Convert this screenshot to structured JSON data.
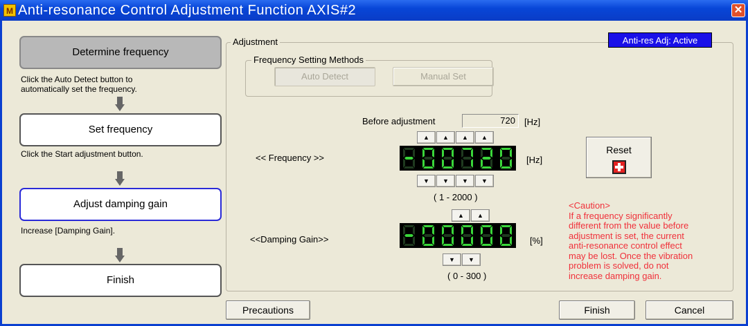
{
  "window": {
    "title": "Anti-resonance Control Adjustment Function AXIS#2",
    "app_icon": "M",
    "close_glyph": "✕"
  },
  "flow": {
    "steps": [
      {
        "label": "Determine frequency",
        "hint": [
          "Click the Auto Detect button to",
          "automatically set the frequency."
        ]
      },
      {
        "label": "Set frequency",
        "hint": [
          "Click the Start adjustment button."
        ]
      },
      {
        "label": "Adjust damping gain",
        "hint": [
          "Increase [Damping Gain]."
        ]
      },
      {
        "label": "Finish",
        "hint": []
      }
    ]
  },
  "adjustment": {
    "group_title": "Adjustment",
    "status_badge": "Anti-res Adj: Active",
    "freq_methods_title": "Frequency Setting Methods",
    "auto_detect_label": "Auto Detect",
    "manual_set_label": "Manual Set",
    "before_adjustment_label": "Before adjustment",
    "before_adjustment_value": "720",
    "hz_unit": "[Hz]",
    "frequency_label": "<< Frequency >>",
    "frequency_digits": "00720",
    "frequency_unit": "[Hz]",
    "frequency_range": "( 1 - 2000 )",
    "damping_label": "<<Damping Gain>>",
    "damping_digits": "00000",
    "damping_unit": "[%]",
    "damping_range": "( 0 - 300 )",
    "spin_up_glyph": "▲",
    "spin_down_glyph": "▼"
  },
  "reset": {
    "label": "Reset",
    "icon": "red-cross-icon"
  },
  "caution": {
    "lines": [
      "<Caution>",
      "If a frequency significantly",
      "different from the value before",
      "adjustment is set, the current",
      "anti-resonance control effect",
      "may be lost. Once the vibration",
      "problem is solved, do not",
      "increase damping gain."
    ]
  },
  "footer": {
    "precautions_label": "Precautions",
    "finish_label": "Finish",
    "cancel_label": "Cancel"
  },
  "colors": {
    "title_bar": "#0a3cc6",
    "status_badge": "#1a10e8",
    "caution_text": "#f0303a",
    "segment_on": "#3ad63a",
    "segment_off": "#1f3a1f"
  }
}
